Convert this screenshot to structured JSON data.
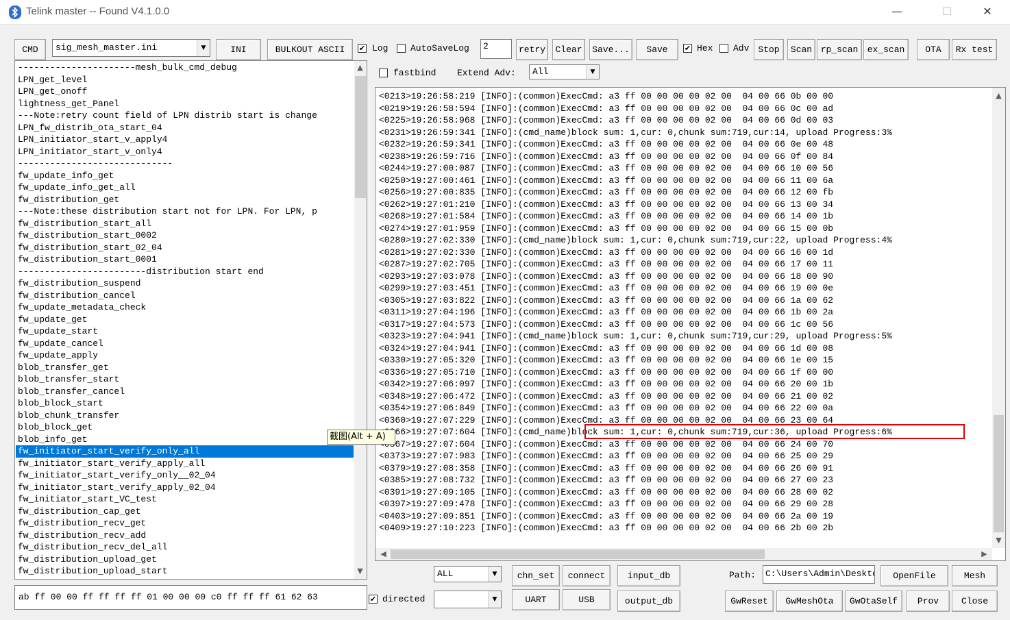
{
  "window": {
    "title": "Telink master -- Found    V4.1.0.0",
    "minimize": "—",
    "maximize": "☐",
    "close": "✕"
  },
  "toolbar": {
    "cmd": "CMD",
    "ini_file": "sig_mesh_master.ini",
    "ini": "INI",
    "bulkout": "BULKOUT ASCII",
    "log_label": "Log",
    "log_checked": true,
    "autosave_label": "AutoSaveLog",
    "autosave_checked": false,
    "retry_value": "2",
    "retry": "retry",
    "clear": "Clear",
    "save_dots": "Save...",
    "save": "Save",
    "hex_label": "Hex",
    "hex_checked": true,
    "adv_label": "Adv",
    "adv_checked": false,
    "stop": "Stop",
    "scan": "Scan",
    "rp_scan": "rp_scan",
    "ex_scan": "ex_scan",
    "ota": "OTA",
    "rx_test": "Rx test"
  },
  "options": {
    "fastbind_label": "fastbind",
    "fastbind_checked": false,
    "extend_adv_label": "Extend Adv:",
    "extend_adv_value": "All"
  },
  "cmd_list": {
    "items": [
      "----------------------mesh_bulk_cmd_debug",
      "LPN_get_level",
      "LPN_get_onoff",
      "lightness_get_Panel",
      "---Note:retry count field of LPN distrib start is change",
      "LPN_fw_distrib_ota_start_04",
      "LPN_initiator_start_v_apply4",
      "LPN_initiator_start_v_only4",
      "-----------------------------",
      "fw_update_info_get",
      "fw_update_info_get_all",
      "fw_distribution_get",
      "---Note:these distribution start not for LPN. For LPN, p",
      "fw_distribution_start_all",
      "fw_distribution_start_0002",
      "fw_distribution_start_02_04",
      "fw_distribution_start_0001",
      "------------------------distribution start end",
      "fw_distribution_suspend",
      "fw_distribution_cancel",
      "fw_update_metadata_check",
      "fw_update_get",
      "fw_update_start",
      "fw_update_cancel",
      "fw_update_apply",
      "blob_transfer_get",
      "blob_transfer_start",
      "blob_transfer_cancel",
      "blob_block_start",
      "blob_chunk_transfer",
      "blob_block_get",
      "blob_info_get",
      "fw_initiator_start_verify_only_all",
      "fw_initiator_start_verify_apply_all",
      "fw_initiator_start_verify_only__02_04",
      "fw_initiator_start_verify_apply_02_04",
      "fw_initiator_start_VC_test",
      "fw_distribution_cap_get",
      "fw_distribution_recv_get",
      "fw_distribution_recv_add",
      "fw_distribution_recv_del_all",
      "fw_distribution_upload_get",
      "fw_distribution_upload_start"
    ],
    "selected_index": 32
  },
  "tooltip": "截图(Alt + A)",
  "log": {
    "lines": [
      "<0213>19:26:58:219 [INFO]:(common)ExecCmd: a3 ff 00 00 00 00 02 00  04 00 66 0b 00 00",
      "<0219>19:26:58:594 [INFO]:(common)ExecCmd: a3 ff 00 00 00 00 02 00  04 00 66 0c 00 ad",
      "<0225>19:26:58:968 [INFO]:(common)ExecCmd: a3 ff 00 00 00 00 02 00  04 00 66 0d 00 03",
      "<0231>19:26:59:341 [INFO]:(cmd_name)block sum: 1,cur: 0,chunk sum:719,cur:14, upload Progress:3%",
      "<0232>19:26:59:341 [INFO]:(common)ExecCmd: a3 ff 00 00 00 00 02 00  04 00 66 0e 00 48",
      "<0238>19:26:59:716 [INFO]:(common)ExecCmd: a3 ff 00 00 00 00 02 00  04 00 66 0f 00 84",
      "<0244>19:27:00:087 [INFO]:(common)ExecCmd: a3 ff 00 00 00 00 02 00  04 00 66 10 00 56",
      "<0250>19:27:00:461 [INFO]:(common)ExecCmd: a3 ff 00 00 00 00 02 00  04 00 66 11 00 6a",
      "<0256>19:27:00:835 [INFO]:(common)ExecCmd: a3 ff 00 00 00 00 02 00  04 00 66 12 00 fb",
      "<0262>19:27:01:210 [INFO]:(common)ExecCmd: a3 ff 00 00 00 00 02 00  04 00 66 13 00 34",
      "<0268>19:27:01:584 [INFO]:(common)ExecCmd: a3 ff 00 00 00 00 02 00  04 00 66 14 00 1b",
      "<0274>19:27:01:959 [INFO]:(common)ExecCmd: a3 ff 00 00 00 00 02 00  04 00 66 15 00 0b",
      "<0280>19:27:02:330 [INFO]:(cmd_name)block sum: 1,cur: 0,chunk sum:719,cur:22, upload Progress:4%",
      "<0281>19:27:02:330 [INFO]:(common)ExecCmd: a3 ff 00 00 00 00 02 00  04 00 66 16 00 1d",
      "<0287>19:27:02:705 [INFO]:(common)ExecCmd: a3 ff 00 00 00 00 02 00  04 00 66 17 00 11",
      "<0293>19:27:03:078 [INFO]:(common)ExecCmd: a3 ff 00 00 00 00 02 00  04 00 66 18 00 90",
      "<0299>19:27:03:451 [INFO]:(common)ExecCmd: a3 ff 00 00 00 00 02 00  04 00 66 19 00 0e",
      "<0305>19:27:03:822 [INFO]:(common)ExecCmd: a3 ff 00 00 00 00 02 00  04 00 66 1a 00 62",
      "<0311>19:27:04:196 [INFO]:(common)ExecCmd: a3 ff 00 00 00 00 02 00  04 00 66 1b 00 2a",
      "<0317>19:27:04:573 [INFO]:(common)ExecCmd: a3 ff 00 00 00 00 02 00  04 00 66 1c 00 56",
      "<0323>19:27:04:941 [INFO]:(cmd_name)block sum: 1,cur: 0,chunk sum:719,cur:29, upload Progress:5%",
      "<0324>19:27:04:941 [INFO]:(common)ExecCmd: a3 ff 00 00 00 00 02 00  04 00 66 1d 00 08",
      "<0330>19:27:05:320 [INFO]:(common)ExecCmd: a3 ff 00 00 00 00 02 00  04 00 66 1e 00 15",
      "<0336>19:27:05:710 [INFO]:(common)ExecCmd: a3 ff 00 00 00 00 02 00  04 00 66 1f 00 00",
      "<0342>19:27:06:097 [INFO]:(common)ExecCmd: a3 ff 00 00 00 00 02 00  04 00 66 20 00 1b",
      "<0348>19:27:06:472 [INFO]:(common)ExecCmd: a3 ff 00 00 00 00 02 00  04 00 66 21 00 02",
      "<0354>19:27:06:849 [INFO]:(common)ExecCmd: a3 ff 00 00 00 00 02 00  04 00 66 22 00 0a",
      "<0360>19:27:07:229 [INFO]:(common)ExecCmd: a3 ff 00 00 00 00 02 00  04 00 66 23 00 64",
      "<0366>19:27:07:604 [INFO]:(cmd_name)block sum: 1,cur: 0,chunk sum:719,cur:36, upload Progress:6%",
      "<0367>19:27:07:604 [INFO]:(common)ExecCmd: a3 ff 00 00 00 00 02 00  04 00 66 24 00 70",
      "<0373>19:27:07:983 [INFO]:(common)ExecCmd: a3 ff 00 00 00 00 02 00  04 00 66 25 00 29",
      "<0379>19:27:08:358 [INFO]:(common)ExecCmd: a3 ff 00 00 00 00 02 00  04 00 66 26 00 91",
      "<0385>19:27:08:732 [INFO]:(common)ExecCmd: a3 ff 00 00 00 00 02 00  04 00 66 27 00 23",
      "<0391>19:27:09:105 [INFO]:(common)ExecCmd: a3 ff 00 00 00 00 02 00  04 00 66 28 00 02",
      "<0397>19:27:09:478 [INFO]:(common)ExecCmd: a3 ff 00 00 00 00 02 00  04 00 66 29 00 28",
      "<0403>19:27:09:851 [INFO]:(common)ExecCmd: a3 ff 00 00 00 00 02 00  04 00 66 2a 00 19",
      "<0409>19:27:10:223 [INFO]:(common)ExecCmd: a3 ff 00 00 00 00 02 00  04 00 66 2b 00 2b"
    ]
  },
  "bottom": {
    "raw_input": "ab ff 00 00 ff ff ff ff 01 00 00 00 c0 ff ff ff 61 62 63",
    "directed_label": "directed",
    "directed_checked": true,
    "directed_value": "",
    "mode_value": "ALL",
    "chn_set": "chn_set",
    "connect": "connect",
    "input_db": "input_db",
    "path_label": "Path:",
    "path_value": "C:\\Users\\Admin\\Desktop",
    "open_file": "OpenFile",
    "mesh": "Mesh",
    "uart": "UART",
    "usb": "USB",
    "output_db": "output_db",
    "gw_reset": "GwReset",
    "gw_mesh_ota": "GwMeshOta",
    "gw_ota_self": "GwOtaSelf",
    "prov": "Prov",
    "close": "Close"
  },
  "colors": {
    "selection": "#0078d7",
    "highlight_border": "#e00000",
    "tooltip_bg": "#ffffe1"
  }
}
